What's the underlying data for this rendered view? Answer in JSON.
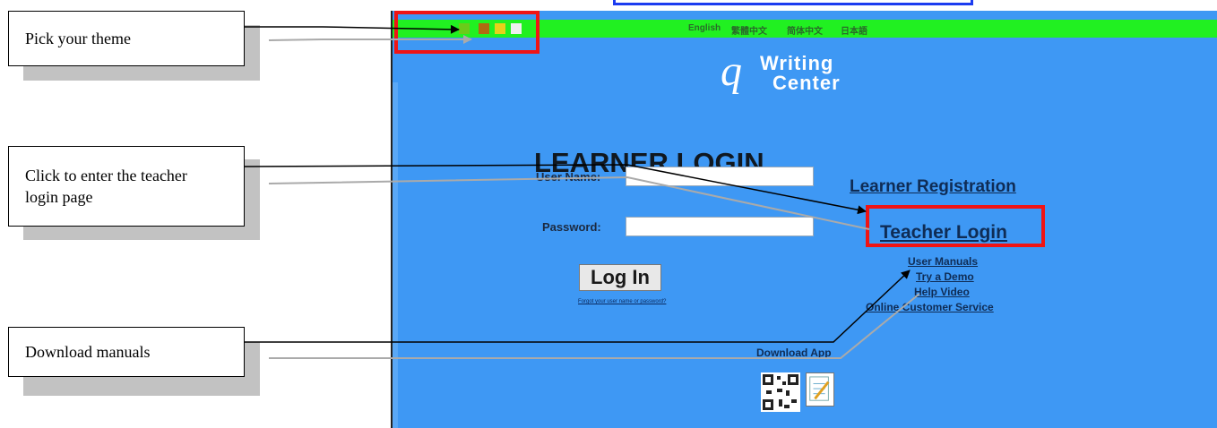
{
  "callouts": [
    {
      "text": "Pick your theme"
    },
    {
      "text": "Click to enter the teacher login page"
    },
    {
      "text": "Download manuals"
    }
  ],
  "toolbar": {
    "theme_colors": [
      "#6acb1a",
      "#b06a10",
      "#e8d01a",
      "#f0f0f0"
    ],
    "languages": [
      "English",
      "繁體中文",
      "简体中文",
      "日本語"
    ]
  },
  "logo": {
    "letter": "q",
    "line1": "Writing",
    "line2": "Center"
  },
  "login": {
    "title": "LEARNER LOGIN",
    "username_label": "User Name:",
    "username_value": "",
    "password_label": "Password:",
    "password_value": "",
    "submit_label": "Log In",
    "forgot_label": "Forgot your user name or password?"
  },
  "links": {
    "learner_registration": "Learner Registration",
    "teacher_login": "Teacher Login",
    "user_manuals": "User Manuals",
    "try_demo": "Try a Demo",
    "help_video": "Help Video",
    "online_service": "Online Customer Service",
    "download_app": "Download App"
  },
  "colors": {
    "panel_bg": "#3e98f4",
    "toolbar_bg": "#21f021",
    "highlight": "#f01414",
    "url_bar": "#1c3cf0"
  }
}
